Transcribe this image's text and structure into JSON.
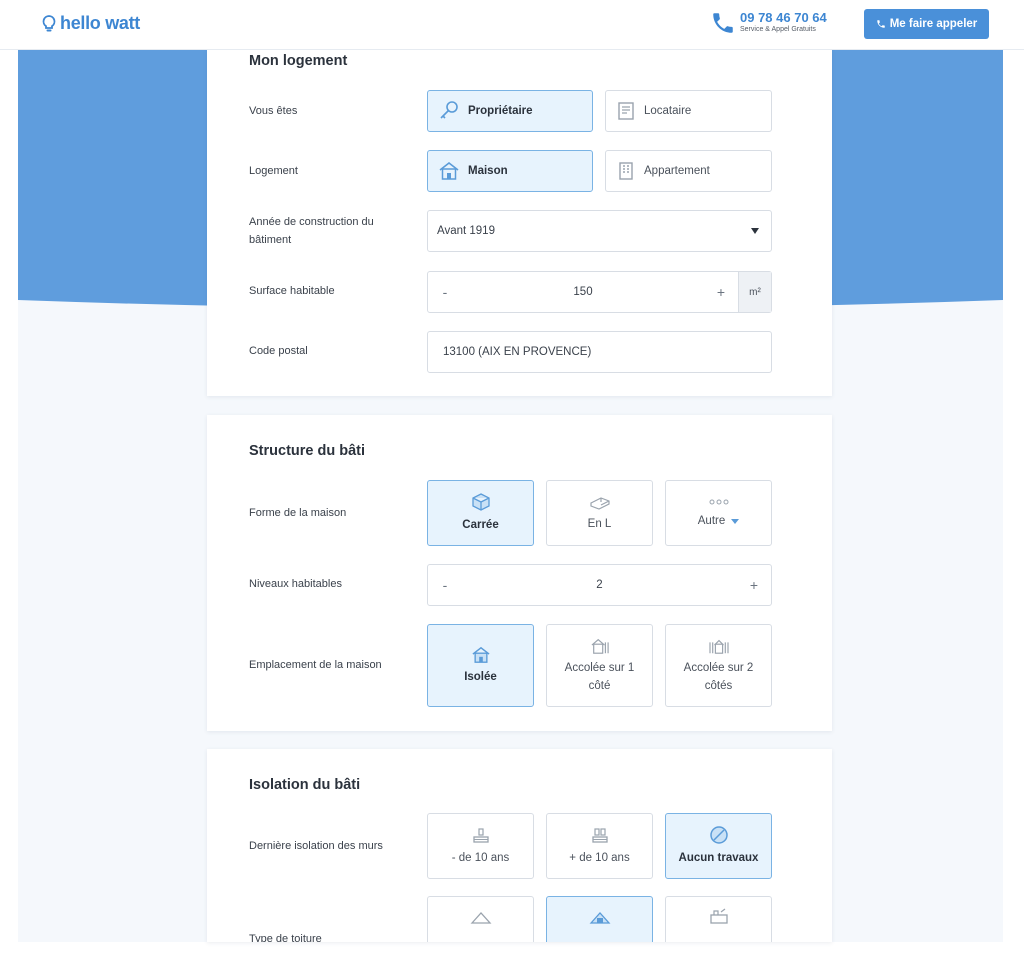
{
  "header": {
    "logo_text": "hello watt",
    "phone_number": "09 78 46 70 64",
    "phone_subtext": "Service & Appel Gratuits",
    "call_button": "Me faire appeler"
  },
  "colors": {
    "accent": "#4a90d9",
    "band": "#5f9ddd",
    "selected_bg": "#e7f3fd"
  },
  "logement": {
    "title": "Mon logement",
    "vous_etes": {
      "label": "Vous êtes",
      "options": [
        "Propriétaire",
        "Locataire"
      ],
      "selected": "Propriétaire"
    },
    "logement": {
      "label": "Logement",
      "options": [
        "Maison",
        "Appartement"
      ],
      "selected": "Maison"
    },
    "annee": {
      "label": "Année de construction du bâtiment",
      "value": "Avant 1919"
    },
    "surface": {
      "label": "Surface habitable",
      "value": "150",
      "unit": "m²",
      "minus": "-",
      "plus": "+"
    },
    "code_postal": {
      "label": "Code postal",
      "value": "13100 (AIX EN PROVENCE)"
    }
  },
  "structure": {
    "title": "Structure du bâti",
    "forme": {
      "label": "Forme de la maison",
      "options": [
        "Carrée",
        "En L",
        "Autre"
      ],
      "selected": "Carrée"
    },
    "niveaux": {
      "label": "Niveaux habitables",
      "value": "2",
      "minus": "-",
      "plus": "+"
    },
    "emplacement": {
      "label": "Emplacement de la maison",
      "options": [
        "Isolée",
        "Accolée sur 1 côté",
        "Accolée sur 2 côtés"
      ],
      "selected": "Isolée"
    }
  },
  "isolation": {
    "title": "Isolation du bâti",
    "murs": {
      "label": "Dernière isolation des murs",
      "options": [
        "- de 10 ans",
        "+ de 10 ans",
        "Aucun travaux"
      ],
      "selected": "Aucun travaux"
    },
    "toiture": {
      "label": "Type de toiture"
    }
  }
}
